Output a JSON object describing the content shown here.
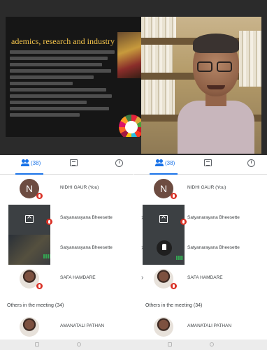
{
  "slide": {
    "title": "ademics, research and industry",
    "highlights": {
      "title": "#f2c24a",
      "emphasis": "#ffcc33"
    }
  },
  "left_panel": {
    "tabs": [
      {
        "label": "(38)",
        "icon": "people-icon"
      },
      {
        "label": "",
        "icon": "chat-icon"
      },
      {
        "label": "",
        "icon": "info-icon"
      }
    ],
    "participants": [
      {
        "name": "NIDHI GAUR (You)",
        "avatar_letter": "N",
        "muted": true
      },
      {
        "name": "Satyanarayana Bheesette",
        "tile": "presenting",
        "muted": true
      },
      {
        "name": "Satyanarayana Bheesette",
        "tile": "camera",
        "muted": false
      },
      {
        "name": "SAFA HAMDARE",
        "muted": true
      }
    ],
    "section_label": "Others in the meeting (34)",
    "others": [
      {
        "name": "AMANATALI PATHAN"
      }
    ]
  },
  "right_panel": {
    "tabs": [
      {
        "label": "(38)",
        "icon": "people-icon"
      },
      {
        "label": "",
        "icon": "chat-icon"
      },
      {
        "label": "",
        "icon": "info-icon"
      }
    ],
    "participants": [
      {
        "name": "NIDHI GAUR (You)",
        "avatar_letter": "N",
        "muted": true
      },
      {
        "name": "Satyanarayana Bheesette",
        "tile": "presenting",
        "muted": true
      },
      {
        "name": "Satyanarayana Bheesette",
        "tile": "pinned",
        "muted": false
      },
      {
        "name": "SAFA HAMDARE",
        "muted": true
      }
    ],
    "section_label": "Others in the meeting (34)",
    "others": [
      {
        "name": "AMANATALI PATHAN"
      }
    ]
  },
  "colors": {
    "accent": "#1a73e8",
    "muted_badge": "#d93025",
    "speaking": "#34a853",
    "avatar_letter_bg": "#6d4c41"
  }
}
